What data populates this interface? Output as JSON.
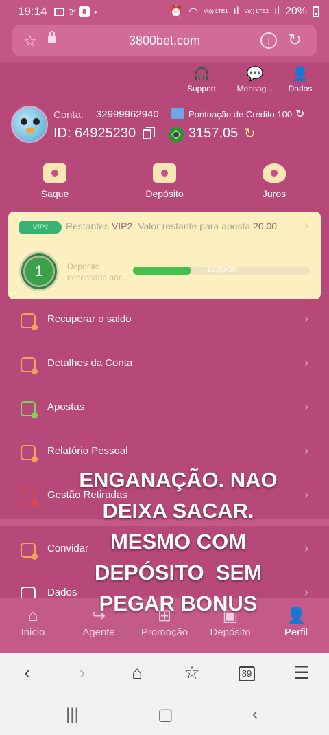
{
  "statusbar": {
    "time": "19:14",
    "battery": "20%",
    "sim1": "Vo)) LTE1",
    "sim2": "Vo)) LTE2"
  },
  "browser": {
    "url": "3800bet.com",
    "tab_count": "89"
  },
  "top_icons": [
    {
      "label": "Support",
      "icon": "headset-icon"
    },
    {
      "label": "Mensag...",
      "icon": "chat-icon"
    },
    {
      "label": "Dados",
      "icon": "user-settings-icon"
    }
  ],
  "profile": {
    "conta_label": "Conta:",
    "conta_number": "32999962940",
    "credit_label": "Pontuação de Crédito:100",
    "id_label": "ID: 64925230",
    "balance": "3157,05"
  },
  "actions": [
    {
      "label": "Saque",
      "icon": "ticket-icon"
    },
    {
      "label": "Depósito",
      "icon": "wallet-icon"
    },
    {
      "label": "Juros",
      "icon": "piggy-bank-icon"
    }
  ],
  "vip": {
    "tag": "VIP1",
    "restantes": "Restantes",
    "level": "VIP2",
    "valor_label": "Valor restante para aposta",
    "valor_amount": "20,00",
    "medal_level": "1",
    "deposit_label_1": "Depósito",
    "deposit_label_2": "necessário par...",
    "progress_text": "10,00/30",
    "progress_fraction": 0.33
  },
  "menu": [
    {
      "label": "Recuperar o saldo",
      "icon": "recover-balance-icon"
    },
    {
      "label": "Detalhes da Conta",
      "icon": "account-details-icon"
    },
    {
      "label": "Apostas",
      "icon": "bets-icon"
    },
    {
      "label": "Relatório Pessoal",
      "icon": "report-icon"
    },
    {
      "label": "Gestão Retiradas",
      "icon": "withdrawals-icon"
    },
    {
      "label": "Convidar",
      "icon": "invite-icon"
    },
    {
      "label": "Dados",
      "icon": "profile-data-icon"
    }
  ],
  "bottom_nav": [
    {
      "label": "Inicio",
      "icon": "home-icon"
    },
    {
      "label": "Agente",
      "icon": "share-icon"
    },
    {
      "label": "Promoção",
      "icon": "gift-icon"
    },
    {
      "label": "Depósito",
      "icon": "wallet-icon"
    },
    {
      "label": "Perfil",
      "icon": "person-icon",
      "active": true
    }
  ],
  "overlay_text": [
    "ENGANAÇÃO. NAO",
    "DEIXA SACAR.",
    "MESMO COM",
    "DEPÓSITO  SEM",
    "PEGAR BONUS"
  ],
  "colors": {
    "background": "#b7487a",
    "vip_card": "#fdf0c0",
    "progress": "#45c04c",
    "accent": "#f3a25a"
  }
}
